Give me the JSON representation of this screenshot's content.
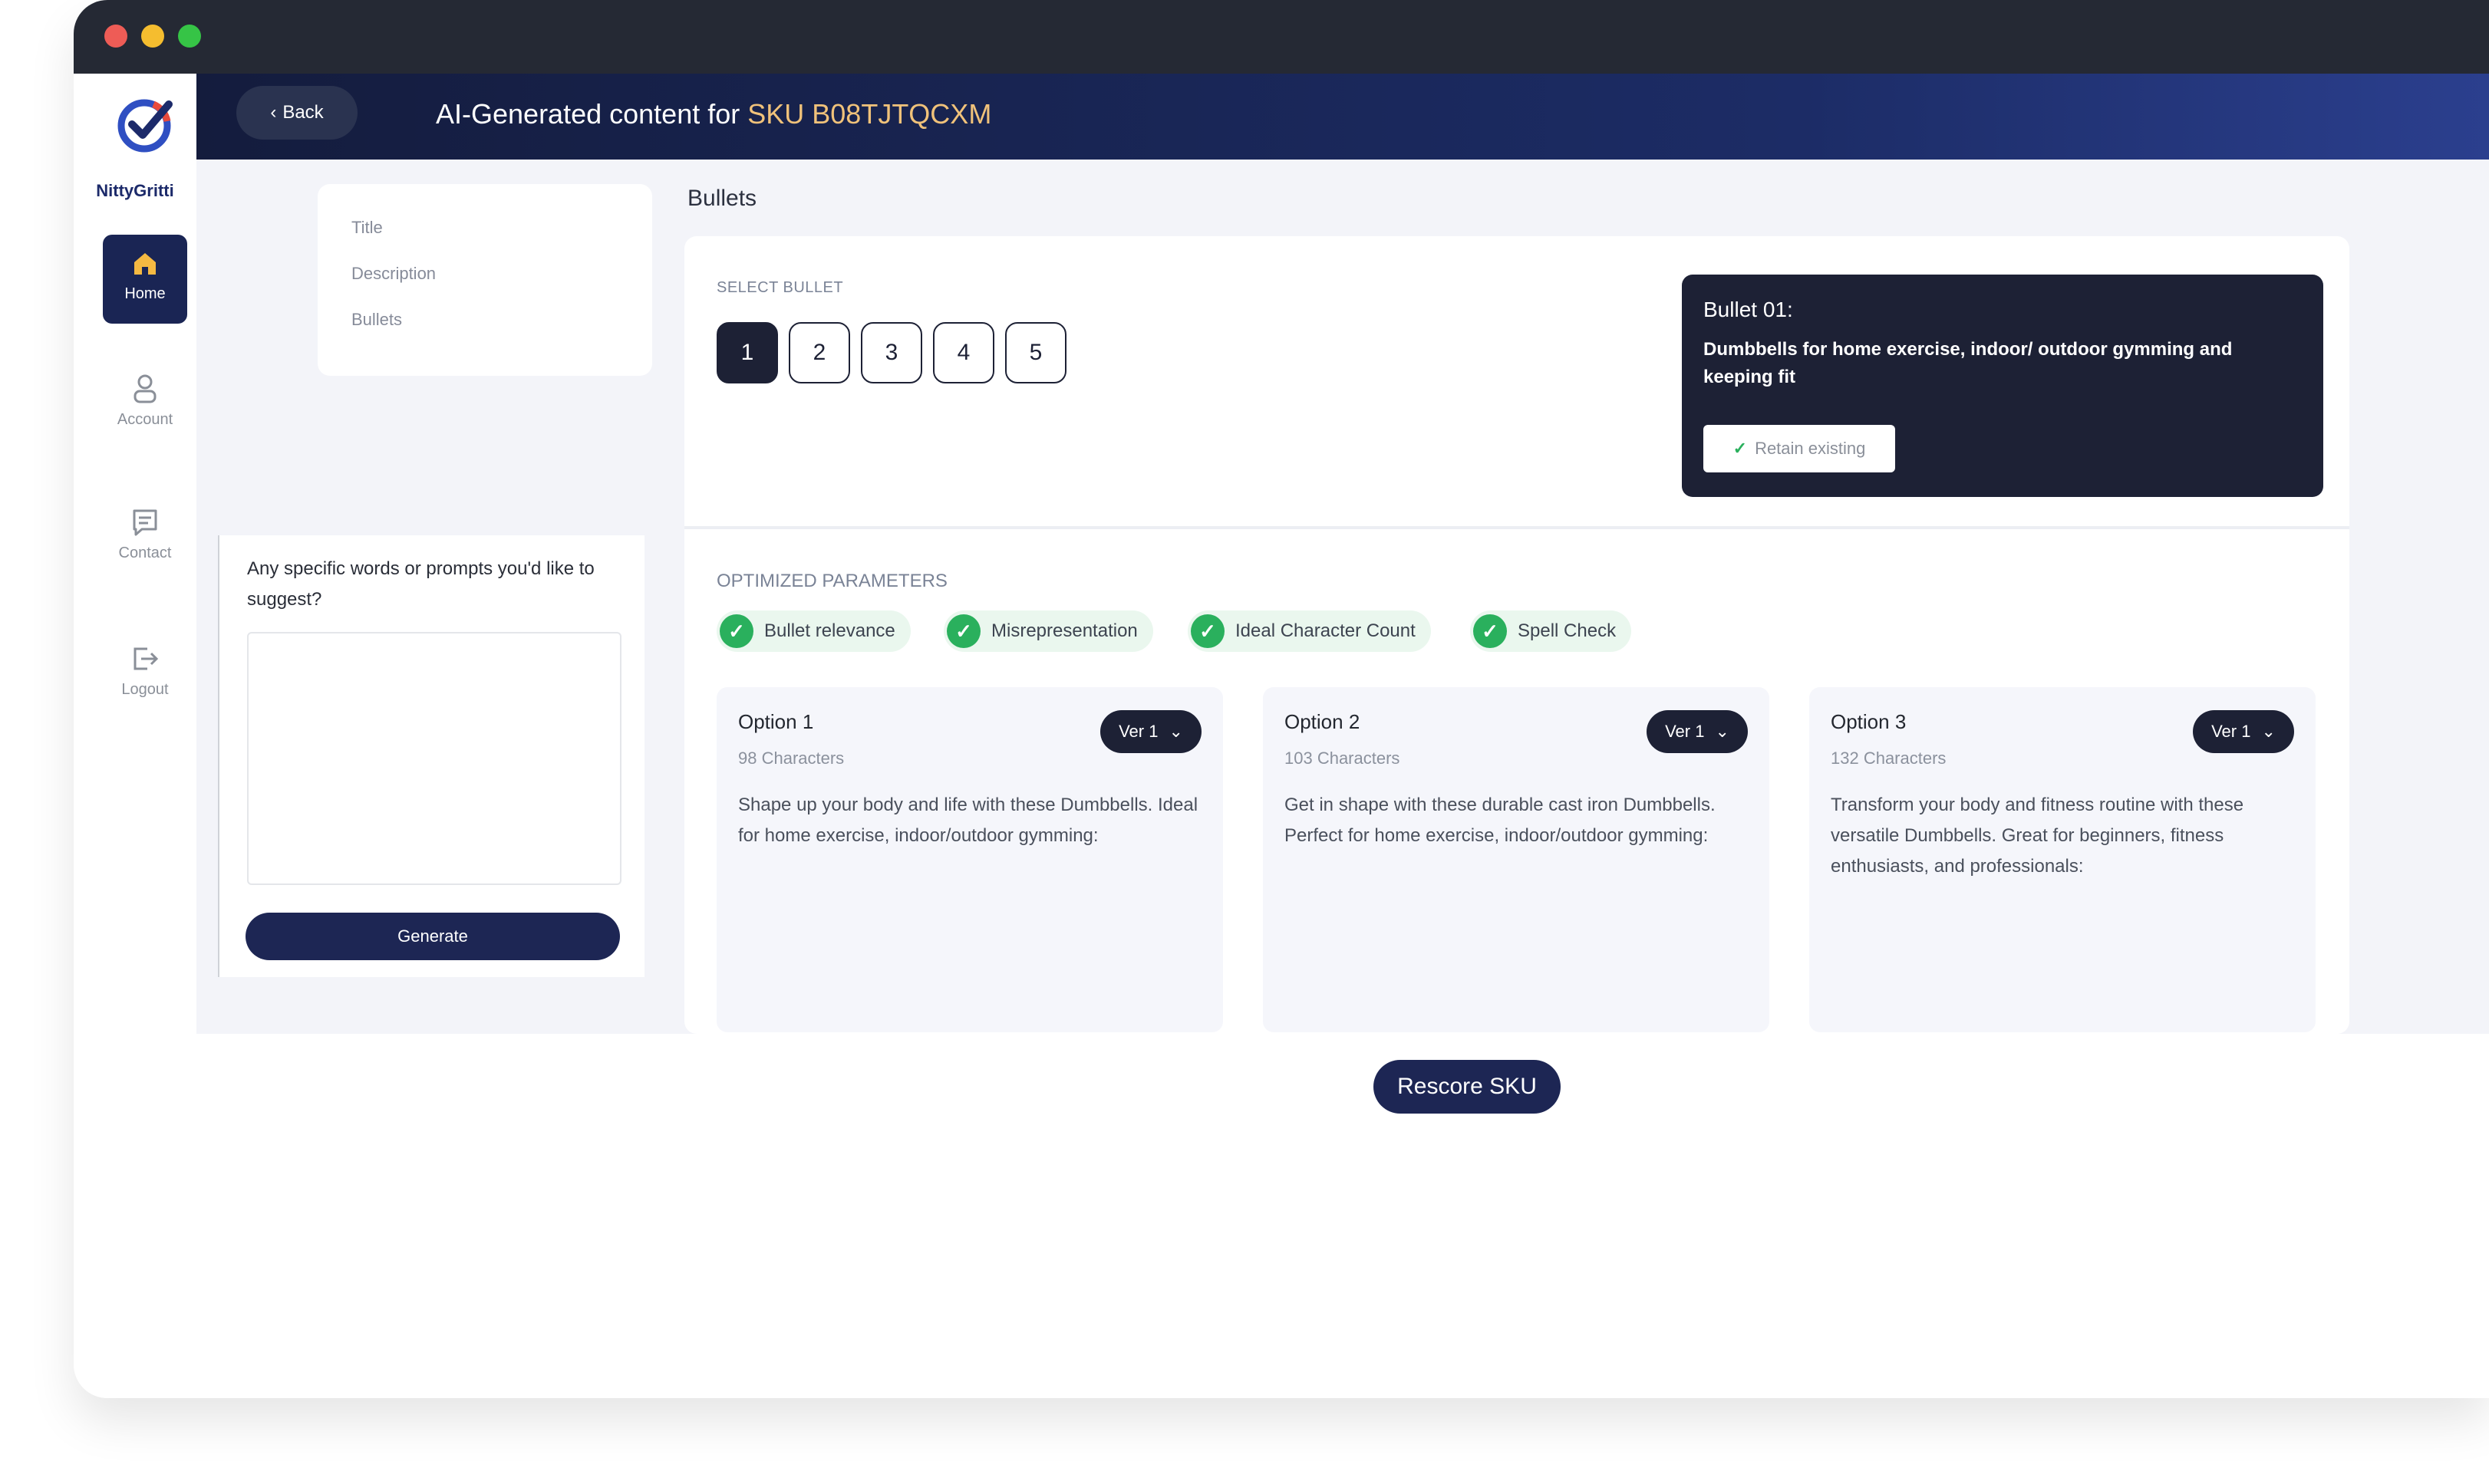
{
  "header": {
    "back_label": "Back",
    "title": "AI-Generated content for",
    "sku": "SKU B08TJTQCXM"
  },
  "brand": {
    "name": "NittyGritti"
  },
  "sidebar": {
    "items": [
      {
        "label": "Home",
        "icon": "home-icon",
        "active": true
      },
      {
        "label": "Account",
        "icon": "account-icon",
        "active": false
      },
      {
        "label": "Contact",
        "icon": "contact-icon",
        "active": false
      },
      {
        "label": "Logout",
        "icon": "logout-icon",
        "active": false
      }
    ]
  },
  "section_nav": {
    "items": [
      "Title",
      "Description",
      "Bullets"
    ]
  },
  "prompt": {
    "label": "Any specific words or prompts you'd like to suggest?",
    "value": "",
    "generate_label": "Generate"
  },
  "bullets": {
    "heading": "Bullets",
    "select_label": "SELECT BULLET",
    "numbers": [
      "1",
      "2",
      "3",
      "4",
      "5"
    ],
    "selected": "1",
    "current": {
      "title": "Bullet 01:",
      "text": "Dumbbells for home exercise, indoor/ outdoor gymming and keeping fit",
      "retain_label": "Retain existing"
    },
    "optimized_label": "OPTIMIZED PARAMETERS",
    "parameters": [
      "Bullet relevance",
      "Misrepresentation",
      "Ideal Character Count",
      "Spell Check"
    ],
    "options": [
      {
        "title": "Option 1",
        "chars": "98 Characters",
        "version": "Ver 1",
        "text": "Shape up your body and life with these Dumbbells. Ideal for home exercise, indoor/outdoor gymming:"
      },
      {
        "title": "Option 2",
        "chars": "103 Characters",
        "version": "Ver 1",
        "text": "Get in shape with these durable cast iron Dumbbells. Perfect for home exercise, indoor/outdoor gymming:"
      },
      {
        "title": "Option 3",
        "chars": "132 Characters",
        "version": "Ver 1",
        "text": "Transform your body and fitness routine with these versatile Dumbbells. Great for beginners, fitness enthusiasts, and professionals:"
      }
    ]
  },
  "footer": {
    "rescore_label": "Rescore SKU"
  },
  "colors": {
    "header_dark": "#141c3d",
    "accent_navy": "#1d2135",
    "sku_gold": "#f0c27a",
    "check_green": "#2ab05d"
  }
}
